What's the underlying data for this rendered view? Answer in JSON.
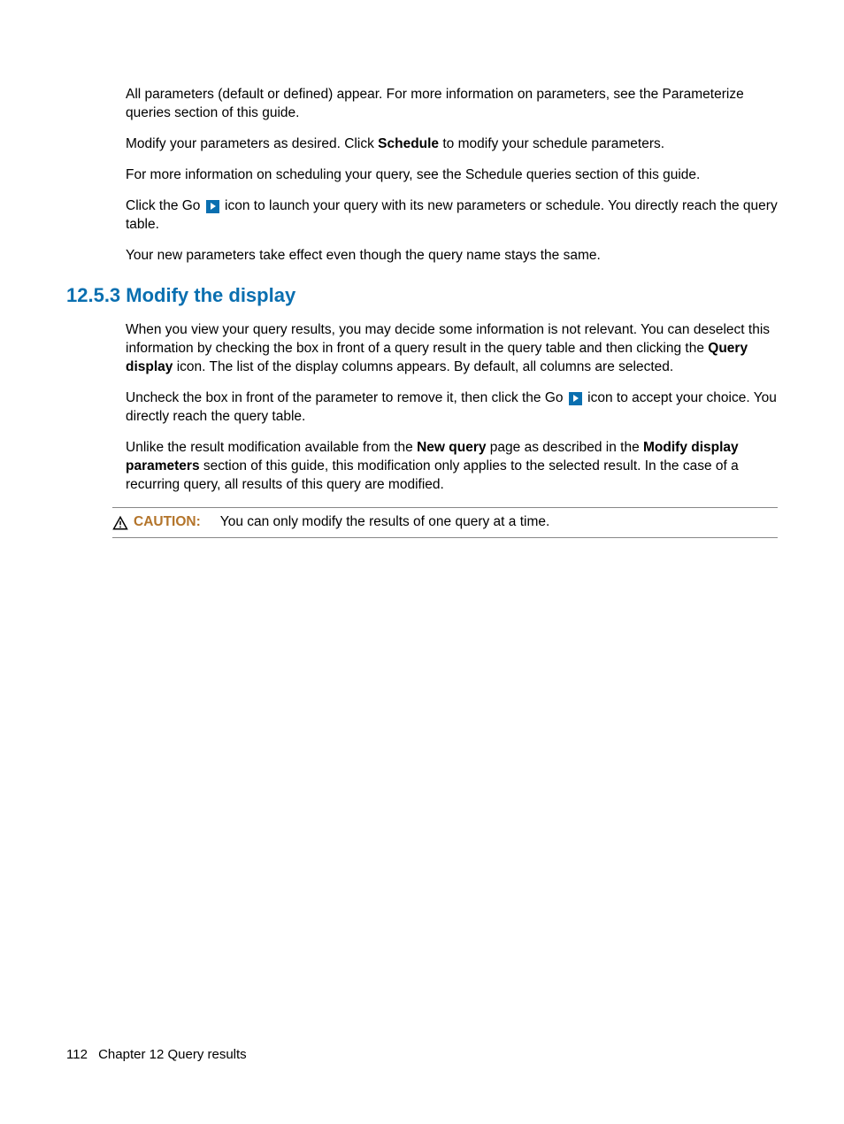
{
  "body": {
    "p1": "All parameters (default or defined) appear. For more information on parameters, see the Parameterize queries section of this guide.",
    "p2_a": "Modify your parameters as desired. Click ",
    "p2_bold": "Schedule",
    "p2_b": " to modify your schedule parameters.",
    "p3": "For more information on scheduling your query, see the Schedule queries section of this guide.",
    "p4_a": "Click the Go ",
    "p4_b": " icon to launch your query with its new parameters or schedule. You directly reach the query table.",
    "p5": "Your new parameters take effect even though the query name stays the same."
  },
  "section": {
    "heading": "12.5.3 Modify the display",
    "p1_a": "When you view your query results, you may decide some information is not relevant. You can deselect this information by checking the box in front of a query result in the query table and then clicking the ",
    "p1_bold": "Query display",
    "p1_b": " icon. The list of the display columns appears. By default, all columns are selected.",
    "p2_a": "Uncheck the box in front of the parameter to remove it, then click the Go ",
    "p2_b": " icon to accept your choice. You directly reach the query table.",
    "p3_a": "Unlike the result modification available from the ",
    "p3_bold1": "New query",
    "p3_b": " page as described in the ",
    "p3_bold2": "Modify display parameters",
    "p3_c": " section of this guide, this modification only applies to the selected result. In the case of a recurring query, all results of this query are modified."
  },
  "caution": {
    "label": "CAUTION:",
    "text": "You can only modify the results of one query at a time."
  },
  "footer": {
    "page": "112",
    "chapter": "Chapter 12   Query results"
  }
}
